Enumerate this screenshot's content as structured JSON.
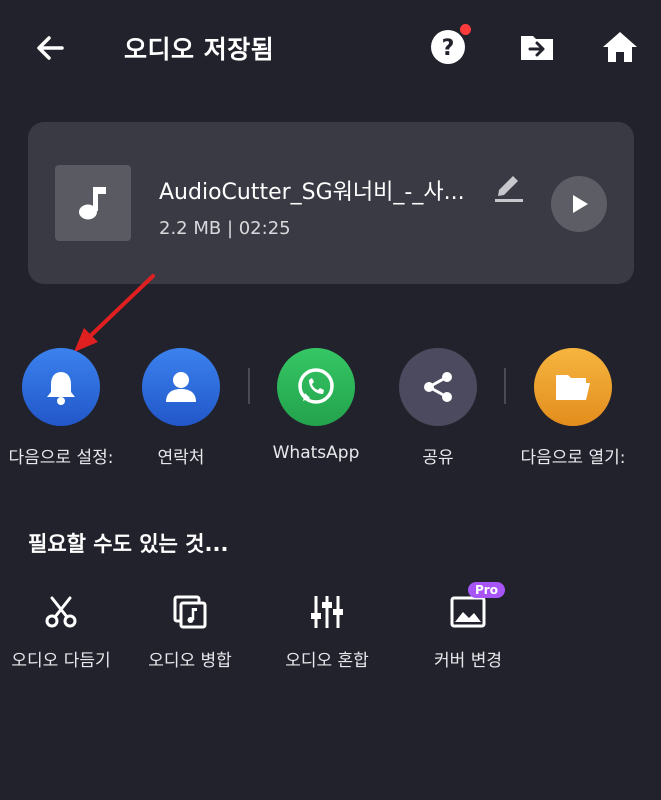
{
  "header": {
    "title": "오디오 저장됨",
    "back_icon": "arrow-left-icon",
    "help_icon": "help-icon",
    "folder_icon": "folder-export-icon",
    "home_icon": "home-icon"
  },
  "file": {
    "name": "AudioCutter_SG워너비_-_사...",
    "meta": "2.2 MB | 02:25",
    "thumb_icon": "music-note-icon"
  },
  "actions": [
    {
      "label": "다음으로 설정:",
      "color": "#2f6fe0"
    },
    {
      "label": "연락처",
      "color": "#2f6fe0"
    },
    {
      "label": "WhatsApp",
      "color": "#2fb85a"
    },
    {
      "label": "공유",
      "color": "#4b4a5e"
    },
    {
      "label": "다음으로 열기:",
      "color": "#f0a22e"
    }
  ],
  "section": {
    "title": "필요할 수도 있는 것..."
  },
  "tools": [
    {
      "label": "오디오 다듬기",
      "icon": "scissors-icon"
    },
    {
      "label": "오디오 병합",
      "icon": "merge-icon"
    },
    {
      "label": "오디오 혼합",
      "icon": "mixer-icon"
    },
    {
      "label": "커버 변경",
      "icon": "image-icon",
      "badge": "Pro"
    }
  ],
  "colors": {
    "background": "#22222c",
    "card": "#3a3a44",
    "annotation_arrow": "#e02020"
  }
}
